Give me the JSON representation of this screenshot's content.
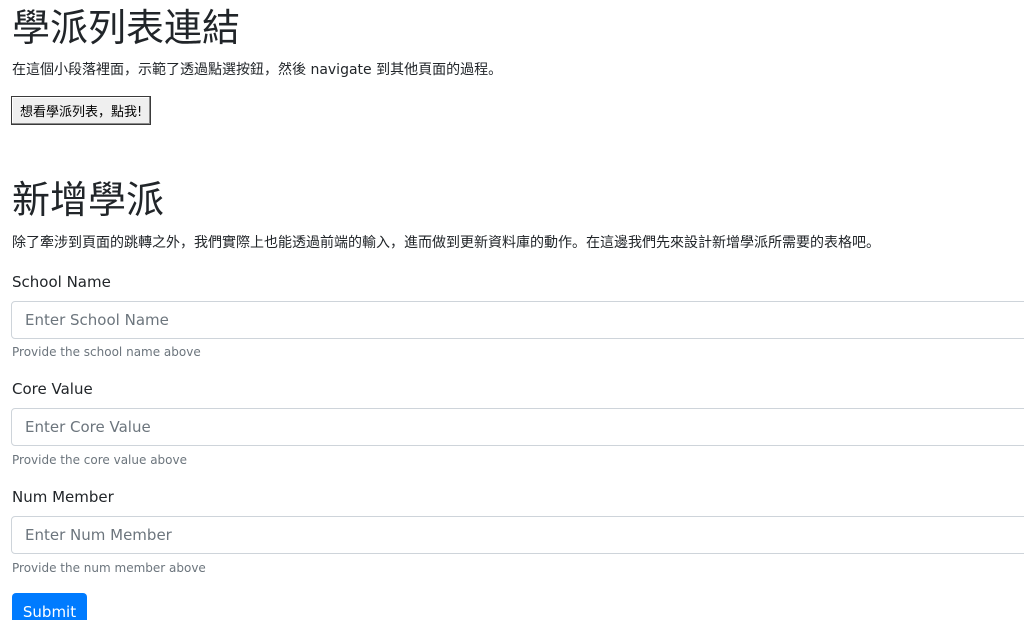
{
  "school_list_section": {
    "heading": "學派列表連結",
    "description": "在這個小段落裡面，示範了透過點選按鈕，然後 navigate 到其他頁面的過程。",
    "button_label": "想看學派列表，點我!"
  },
  "add_school_section": {
    "heading": "新增學派",
    "description": "除了牽涉到頁面的跳轉之外，我們實際上也能透過前端的輸入，進而做到更新資料庫的動作。在這邊我們先來設計新增學派所需要的表格吧。",
    "fields": [
      {
        "label": "School Name",
        "placeholder": "Enter School Name",
        "value": "",
        "help": "Provide the school name above"
      },
      {
        "label": "Core Value",
        "placeholder": "Enter Core Value",
        "value": "",
        "help": "Provide the core value above"
      },
      {
        "label": "Num Member",
        "placeholder": "Enter Num Member",
        "value": "",
        "help": "Provide the num member above"
      }
    ],
    "submit_label": "Submit"
  },
  "colors": {
    "primary": "#007bff",
    "text": "#212529",
    "muted": "#6c757d",
    "input_border": "#ced4da"
  }
}
